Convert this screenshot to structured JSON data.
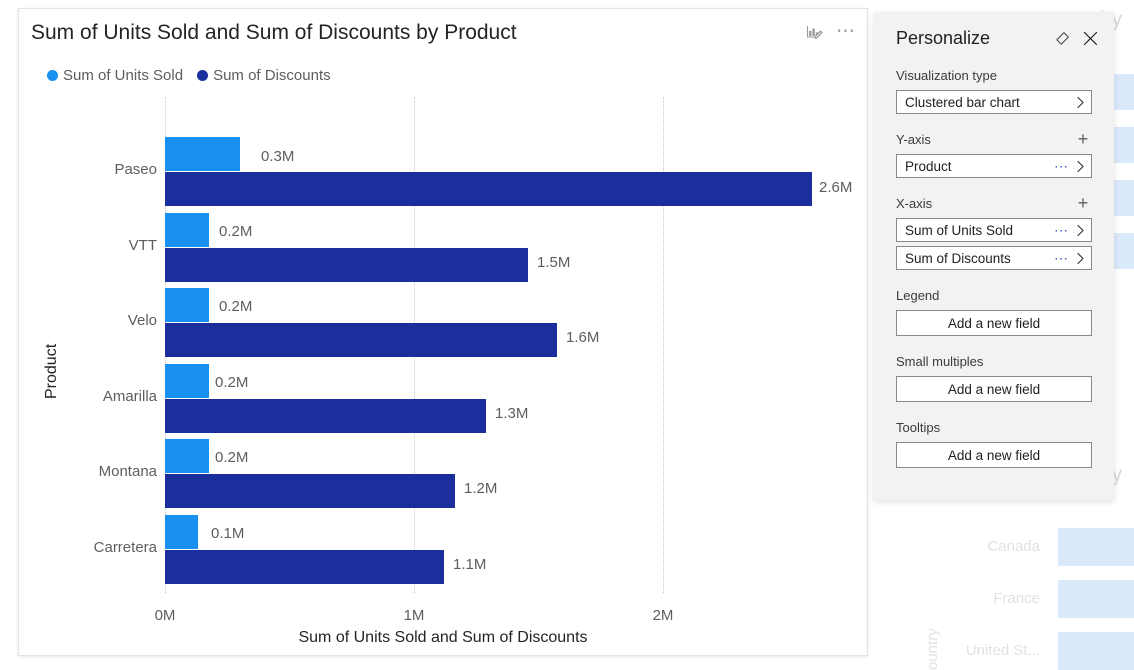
{
  "visual": {
    "title": "Sum of Units Sold and Sum of Discounts by Product",
    "personalize_icon": "personalize-visual-icon",
    "more_options_icon": "more-options-ellipsis-icon"
  },
  "chart_data": {
    "type": "bar",
    "title": "Sum of Units Sold and Sum of Discounts by Product",
    "orientation": "horizontal",
    "categories": [
      "Paseo",
      "VTT",
      "Velo",
      "Amarilla",
      "Montana",
      "Carretera"
    ],
    "series": [
      {
        "name": "Sum of Units Sold",
        "color": "#1890F0",
        "values": [
          0.3,
          0.2,
          0.2,
          0.2,
          0.2,
          0.1
        ],
        "labels": [
          "0.3M",
          "0.2M",
          "0.2M",
          "0.2M",
          "0.2M",
          "0.1M"
        ]
      },
      {
        "name": "Sum of Discounts",
        "color": "#1A2E9E",
        "values": [
          2.6,
          1.5,
          1.6,
          1.3,
          1.2,
          1.1
        ],
        "labels": [
          "2.6M",
          "1.5M",
          "1.6M",
          "1.3M",
          "1.2M",
          "1.1M"
        ]
      }
    ],
    "xlabel": "Sum of Units Sold and Sum of Discounts",
    "ylabel": "Product",
    "xticks": [
      "0M",
      "1M",
      "2M"
    ],
    "xtick_values": [
      0,
      1,
      2
    ],
    "xlim": [
      0,
      2.82
    ],
    "grid": "vertical-dotted",
    "legend": [
      "Sum of Units Sold",
      "Sum of Discounts"
    ],
    "legend_position": "top-left"
  },
  "personalize": {
    "title": "Personalize",
    "reset_icon": "eraser-reset-icon",
    "close_icon": "close-x-icon",
    "groups": [
      {
        "label": "Visualization type",
        "has_add": false,
        "fields": [
          {
            "text": "Clustered bar chart",
            "dots": false
          }
        ]
      },
      {
        "label": "Y-axis",
        "has_add": true,
        "fields": [
          {
            "text": "Product",
            "dots": true
          }
        ]
      },
      {
        "label": "X-axis",
        "has_add": true,
        "fields": [
          {
            "text": "Sum of Units Sold",
            "dots": true
          },
          {
            "text": "Sum of Discounts",
            "dots": true
          }
        ]
      },
      {
        "label": "Legend",
        "has_add": false,
        "add_field_label": "Add a new field"
      },
      {
        "label": "Small multiples",
        "has_add": false,
        "add_field_label": "Add a new field"
      },
      {
        "label": "Tooltips",
        "has_add": false,
        "add_field_label": "Add a new field"
      }
    ]
  },
  "background": {
    "title_fragment_top": "by",
    "title_fragment_mid": "by",
    "axis_title": "ountry",
    "categories": [
      "Canada",
      "France",
      "United St..."
    ]
  }
}
